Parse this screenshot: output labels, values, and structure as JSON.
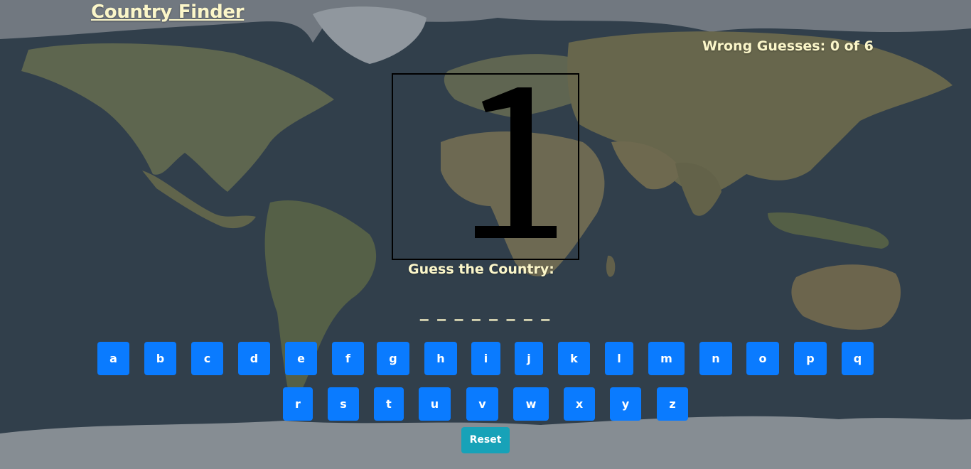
{
  "header": {
    "title": "Country Finder"
  },
  "status": {
    "wrong_guesses_text": "Wrong Guesses: 0 of 6",
    "wrong_guesses": 0,
    "max_wrong": 6
  },
  "hangman": {
    "stage_label": "1"
  },
  "prompt": {
    "text": "Guess the Country:"
  },
  "word": {
    "display": "_ _ _ _ _ _ _ _",
    "length": 8
  },
  "keyboard": {
    "row1": [
      "a",
      "b",
      "c",
      "d",
      "e",
      "f",
      "g",
      "h",
      "i",
      "j",
      "k",
      "l",
      "m",
      "n",
      "o",
      "p",
      "q"
    ],
    "row2": [
      "r",
      "s",
      "t",
      "u",
      "v",
      "w",
      "x",
      "y",
      "z"
    ]
  },
  "controls": {
    "reset_label": "Reset"
  },
  "colors": {
    "title_text": "#fbf6c9",
    "key_bg": "#0a7bff",
    "reset_bg": "#17a2b8",
    "map_ocean": "#33414e"
  },
  "icons": {
    "background": "world-map-icon"
  }
}
